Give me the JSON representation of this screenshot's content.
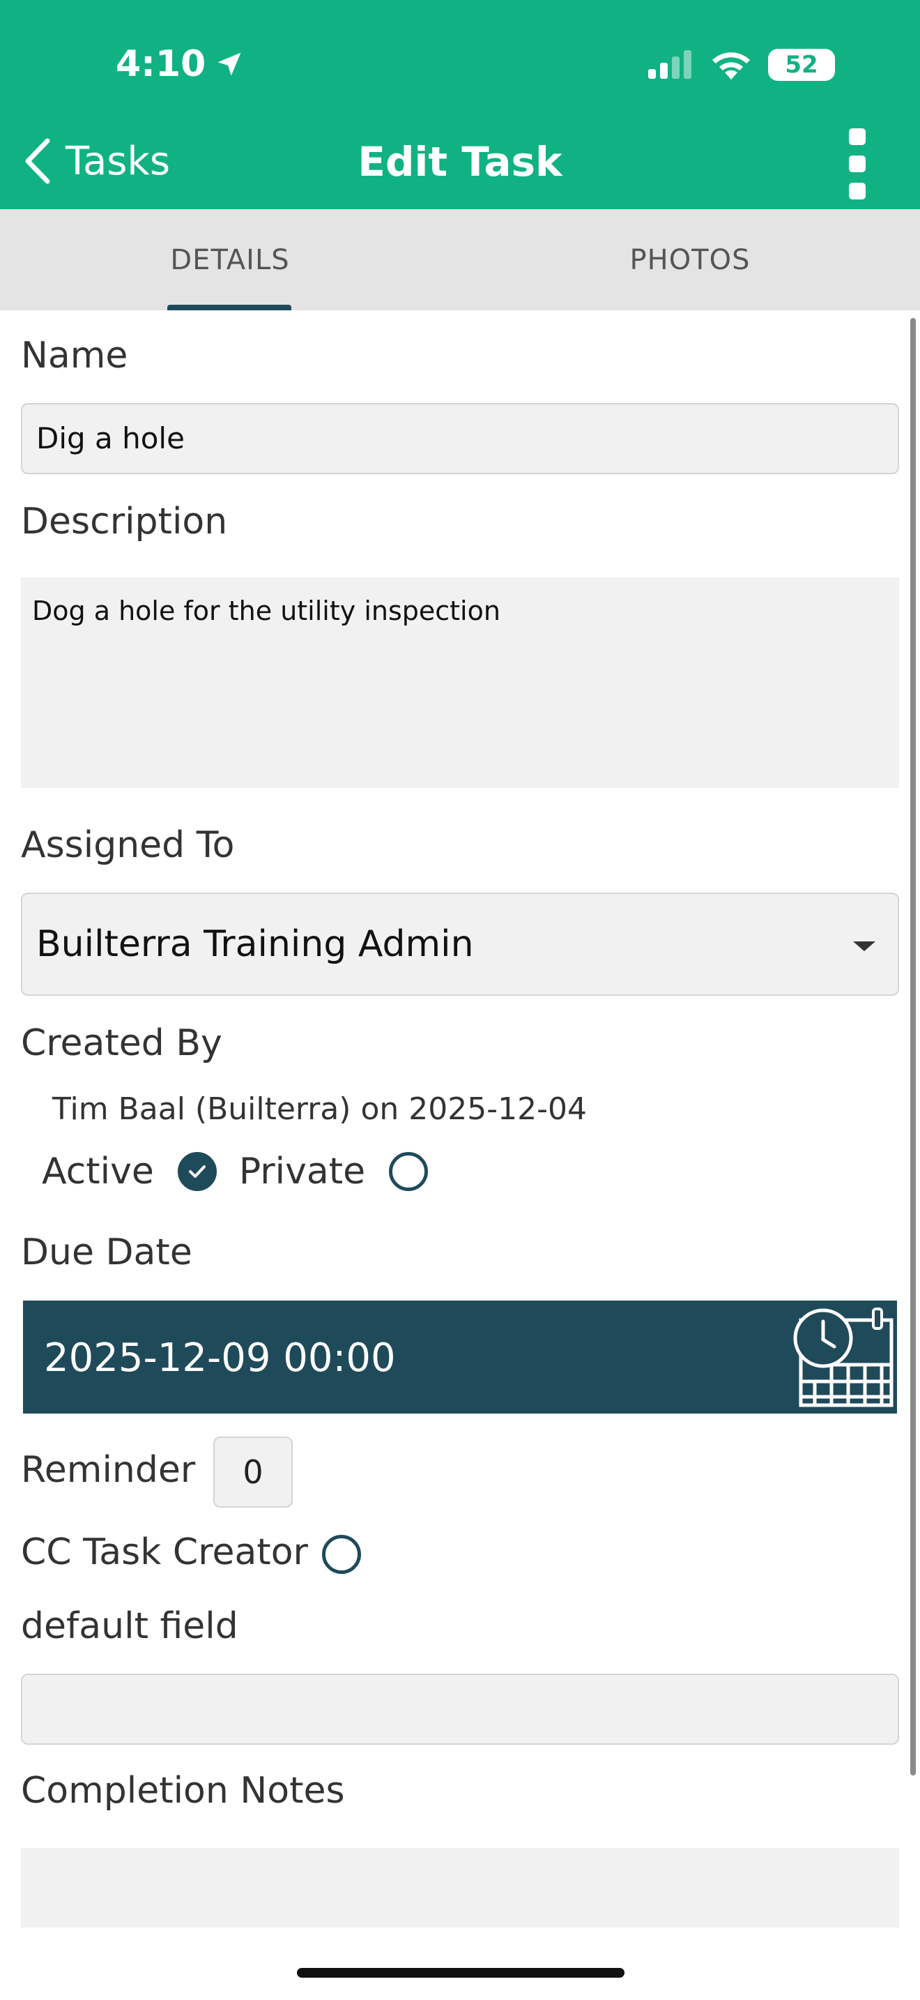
{
  "status_bar": {
    "time": "4:10",
    "battery": "52"
  },
  "nav": {
    "back_label": "Tasks",
    "title": "Edit Task"
  },
  "tabs": [
    {
      "label": "DETAILS",
      "active": true
    },
    {
      "label": "PHOTOS",
      "active": false
    }
  ],
  "form": {
    "name_label": "Name",
    "name_value": "Dig a hole",
    "description_label": "Description",
    "description_value": "Dog a hole for the utility inspection",
    "assigned_to_label": "Assigned To",
    "assigned_to_value": "Builterra Training Admin",
    "created_by_label": "Created By",
    "created_by_value": "Tim Baal (Builterra) on 2025-12-04",
    "active_label": "Active",
    "active_checked": true,
    "private_label": "Private",
    "private_checked": false,
    "due_date_label": "Due Date",
    "due_date_value": "2025-12-09 00:00",
    "reminder_label": "Reminder",
    "reminder_value": "0",
    "cc_task_creator_label": "CC Task Creator",
    "cc_task_creator_checked": false,
    "default_field_label": "default field",
    "default_field_value": "",
    "completion_notes_label": "Completion Notes",
    "completion_notes_value": ""
  },
  "colors": {
    "header": "#10b283",
    "accent": "#1f4a5a",
    "field_bg": "#f1f1f1"
  }
}
